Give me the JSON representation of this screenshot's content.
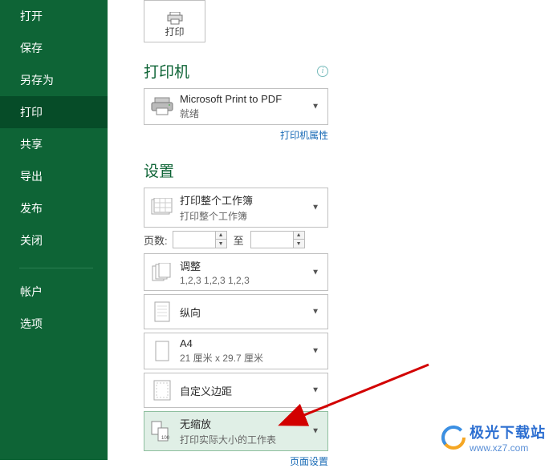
{
  "sidebar": {
    "items": [
      {
        "label": "打开"
      },
      {
        "label": "保存"
      },
      {
        "label": "另存为"
      },
      {
        "label": "打印"
      },
      {
        "label": "共享"
      },
      {
        "label": "导出"
      },
      {
        "label": "发布"
      },
      {
        "label": "关闭"
      }
    ],
    "bottom_items": [
      {
        "label": "帐户"
      },
      {
        "label": "选项"
      }
    ]
  },
  "print_tile": {
    "label": "打印"
  },
  "printer_section": {
    "title": "打印机",
    "device": "Microsoft Print to PDF",
    "status": "就绪",
    "properties_link": "打印机属性"
  },
  "settings_section": {
    "title": "设置",
    "scope": {
      "title": "打印整个工作簿",
      "sub": "打印整个工作簿"
    },
    "pages": {
      "label": "页数:",
      "to": "至",
      "from": "",
      "until": ""
    },
    "collate": {
      "title": "调整",
      "sub": "1,2,3    1,2,3    1,2,3"
    },
    "orientation": {
      "title": "纵向"
    },
    "paper": {
      "title": "A4",
      "sub": "21 厘米 x 29.7 厘米"
    },
    "margins": {
      "title": "自定义边距"
    },
    "scaling": {
      "title": "无缩放",
      "sub": "打印实际大小的工作表"
    },
    "page_setup_link": "页面设置"
  },
  "watermark": {
    "name": "极光下载站",
    "url": "www.xz7.com"
  }
}
